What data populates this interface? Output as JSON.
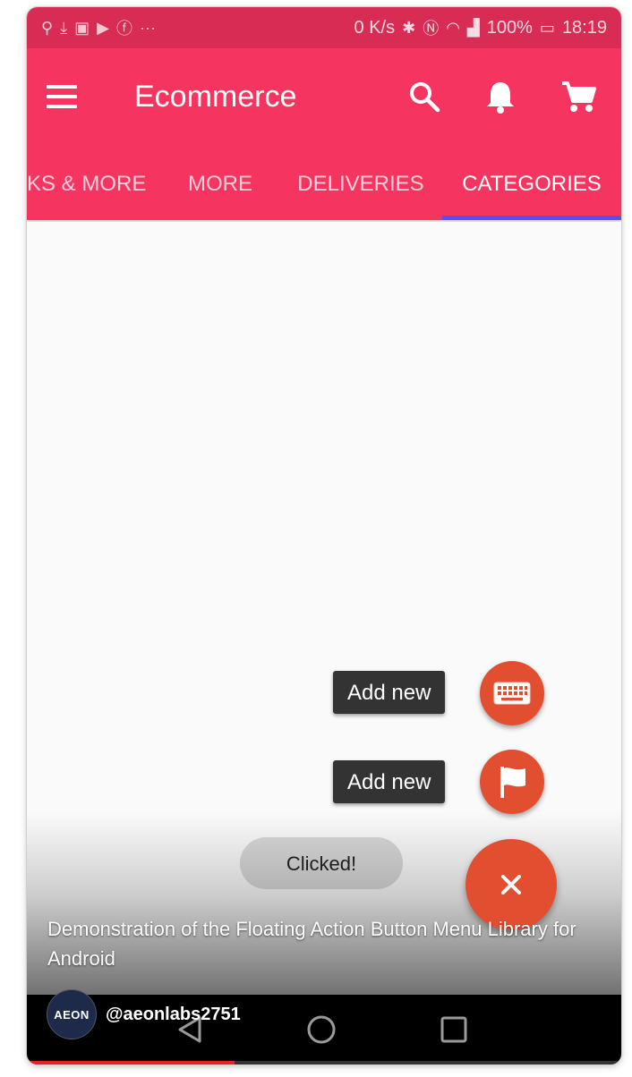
{
  "status_bar": {
    "net_speed": "0 K/s",
    "battery": "100%",
    "time": "18:19",
    "left_icons": [
      "usb-icon",
      "download-icon",
      "gallery-icon",
      "youtube-icon",
      "facebook-icon",
      "more-icon"
    ],
    "right_icons": [
      "bluetooth-icon",
      "nfc-icon",
      "wifi-icon",
      "signal-icon",
      "battery-icon"
    ]
  },
  "app_bar": {
    "title": "Ecommerce",
    "icons": [
      "menu-icon",
      "search-icon",
      "bell-icon",
      "cart-icon"
    ],
    "color": "#f5345f"
  },
  "tabs": [
    {
      "label": "KS & MORE",
      "active": false
    },
    {
      "label": "MORE",
      "active": false
    },
    {
      "label": "DELIVERIES",
      "active": false
    },
    {
      "label": "CATEGORIES",
      "active": true
    }
  ],
  "fab_menu": {
    "items": [
      {
        "label": "Add new",
        "icon": "keyboard-icon"
      },
      {
        "label": "Add new",
        "icon": "flag-icon"
      }
    ],
    "main_icon": "close-icon",
    "color": "#e24f30"
  },
  "toast": "Clicked!",
  "video": {
    "caption": "Demonstration of the Floating Action Button Menu Library for Android",
    "channel": "@aeonlabs2751",
    "avatar_text": "AEON",
    "progress": 0.35
  },
  "nav_bar": {
    "icons": [
      "back-icon",
      "home-icon",
      "recents-icon"
    ]
  }
}
